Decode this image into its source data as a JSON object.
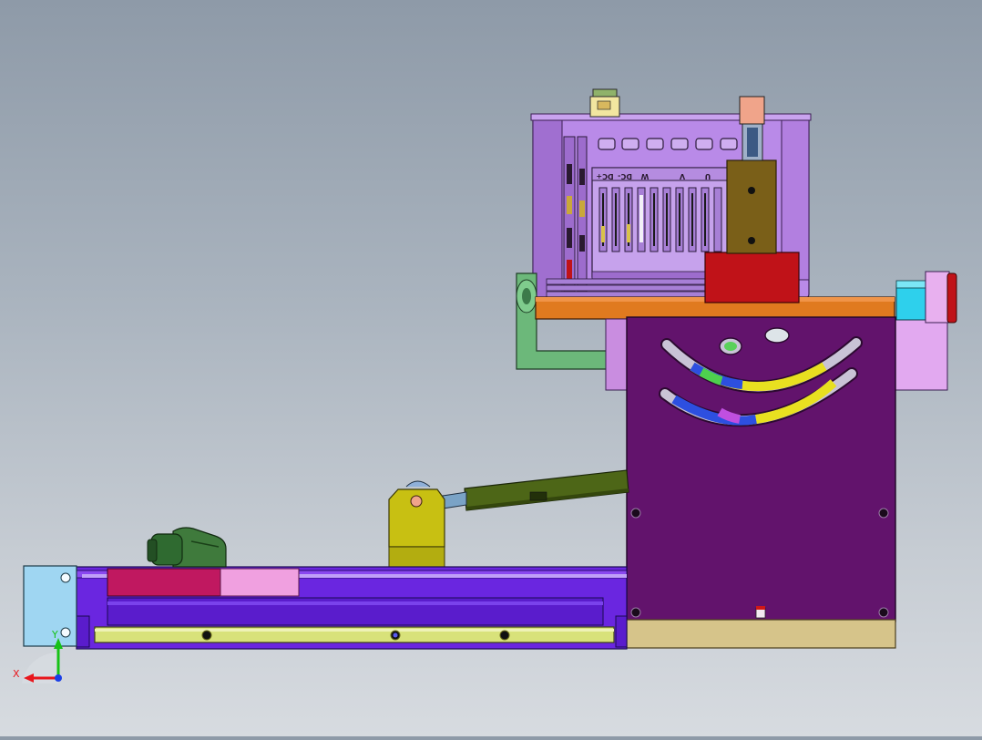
{
  "view": {
    "background_top": "#8e9aa8",
    "background_bottom": "#d7dbe0"
  },
  "motor": {
    "terminal_labels": [
      "DC+",
      "DC-",
      "W",
      "V",
      "U"
    ],
    "body_color": "#a477d6",
    "frame_color": "#b98ae8"
  },
  "colors": {
    "main_plate": "#62136c",
    "top_plate": "#e07a1f",
    "red_block": "#c01218",
    "cylinder": "#4d6617",
    "yellow_block": "#c8c012",
    "rail_base": "#6a26e0",
    "guide_rail": "#d8e27a",
    "tan_base": "#d6c48a",
    "cyan_block": "#2ed0ec",
    "light_blue_end": "#9fd6f2"
  },
  "axis_triad": {
    "x_label": "X",
    "y_label": "Y",
    "x_color": "#e8161c",
    "y_color": "#16c216",
    "z_color": "#1a3ee6"
  }
}
